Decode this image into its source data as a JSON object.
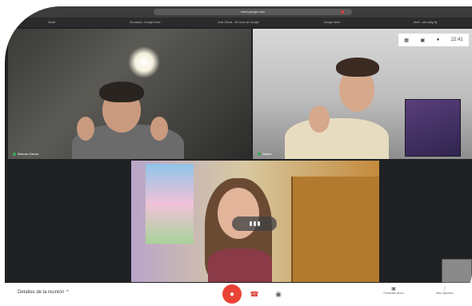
{
  "browser": {
    "url": "meet.google.com",
    "tabs": [
      "Gmail",
      "Mi unidad - Google Drive",
      "Aula Virtual - Mi curso de Google",
      "Google Meet",
      "Meet - abc-defg-hij"
    ]
  },
  "tiles": {
    "top_left": {
      "name": "Marcos García"
    },
    "top_right": {
      "name": "Daniel"
    }
  },
  "overlay": {
    "icon_1": "grid-icon",
    "icon_2": "chat-icon",
    "icon_3": "people-icon",
    "label": "22:41"
  },
  "controls": {
    "meeting_details": "Detalles de la reunión",
    "meeting_details_chevron": "^",
    "end_call_icon": "phone-hangup-icon",
    "mic_icon": "mic-off-icon",
    "cam_icon": "camera-icon",
    "present_label": "Presentar ahora",
    "more_label": "Más opciones"
  },
  "colors": {
    "end_call": "#ea4335",
    "mic_active": "#34a853",
    "bar": "#ffffff"
  }
}
